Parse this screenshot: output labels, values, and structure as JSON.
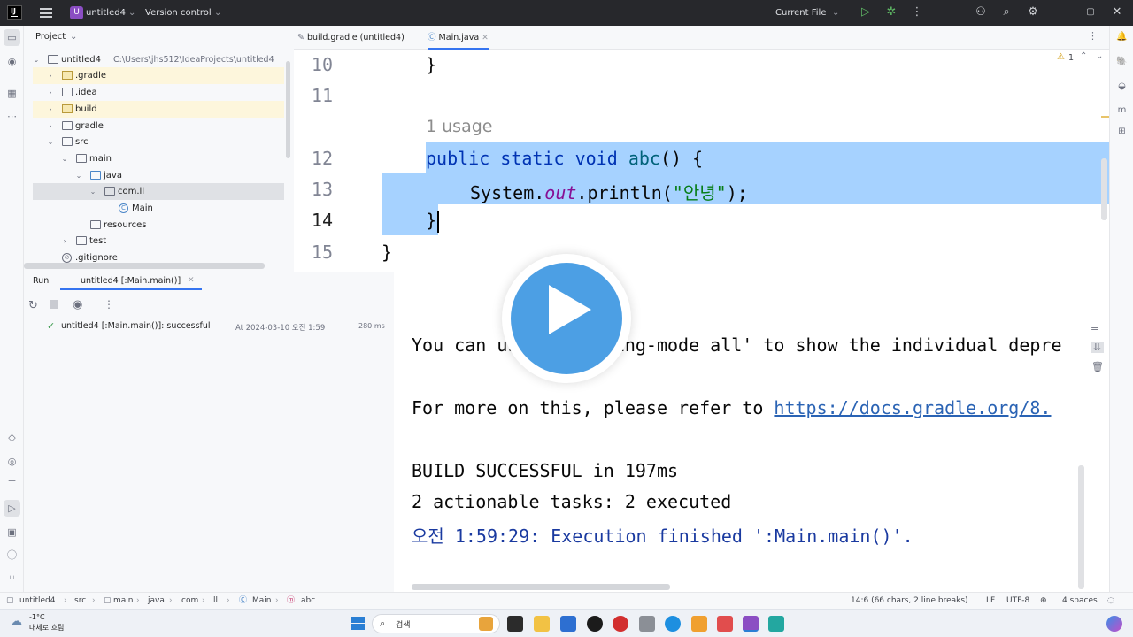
{
  "titlebar": {
    "project_badge": "U",
    "project_name": "untitled4",
    "vcs": "Version control",
    "run_config": "Current File"
  },
  "project_panel": {
    "title": "Project",
    "root_label": "untitled4",
    "root_path": "C:\\Users\\jhs512\\IdeaProjects\\untitled4",
    "items": [
      {
        "label": ".gradle"
      },
      {
        "label": ".idea"
      },
      {
        "label": "build"
      },
      {
        "label": "gradle"
      },
      {
        "label": "src"
      },
      {
        "label": "main"
      },
      {
        "label": "java"
      },
      {
        "label": "com.ll"
      },
      {
        "label": "Main"
      },
      {
        "label": "resources"
      },
      {
        "label": "test"
      },
      {
        "label": ".gitignore"
      }
    ]
  },
  "run_panel": {
    "tab_run": "Run",
    "tab_task": "untitled4 [:Main.main()]",
    "result_label": "untitled4 [:Main.main()]: successful",
    "result_time": "At 2024-03-10 오전 1:59",
    "result_duration": "280 ms"
  },
  "editor": {
    "tabs": [
      {
        "label": "build.gradle (untitled4)"
      },
      {
        "label": "Main.java"
      }
    ],
    "warning_count": "1",
    "line_numbers": [
      "10",
      "11",
      "12",
      "13",
      "14",
      "15"
    ],
    "usage_hint": "1 usage",
    "lines": {
      "l10": "}",
      "l12_kw1": "public",
      "l12_kw2": "static",
      "l12_kw3": "void",
      "l12_fn": "abc",
      "l12_rest": "() {",
      "l13_a": "System.",
      "l13_b": "out",
      "l13_c": ".println(",
      "l13_str": "\"안녕\"",
      "l13_d": ");",
      "l14": "}",
      "l15": "}"
    }
  },
  "console": {
    "line1": "You can use '--warning-mode all' to show the individual depre",
    "line2_text": "For more on this, please refer to ",
    "line2_link": "https://docs.gradle.org/8.",
    "line3": "BUILD SUCCESSFUL in 197ms",
    "line4": "2 actionable tasks: 2 executed",
    "line5": "오전 1:59:29: Execution finished ':Main.main()'."
  },
  "statusbar": {
    "crumbs": [
      "untitled4",
      "src",
      "main",
      "java",
      "com",
      "ll",
      "Main",
      "abc"
    ],
    "position": "14:6 (66 chars, 2 line breaks)",
    "line_sep": "LF",
    "encoding": "UTF-8",
    "indent": "4 spaces"
  },
  "taskbar": {
    "weather_temp": "-1°C",
    "weather_desc": "대체로 흐림",
    "search": "검색"
  },
  "colors": {
    "selection": "#a6d2ff",
    "accent": "#3574f0",
    "play_blue": "#4c9fe4"
  }
}
